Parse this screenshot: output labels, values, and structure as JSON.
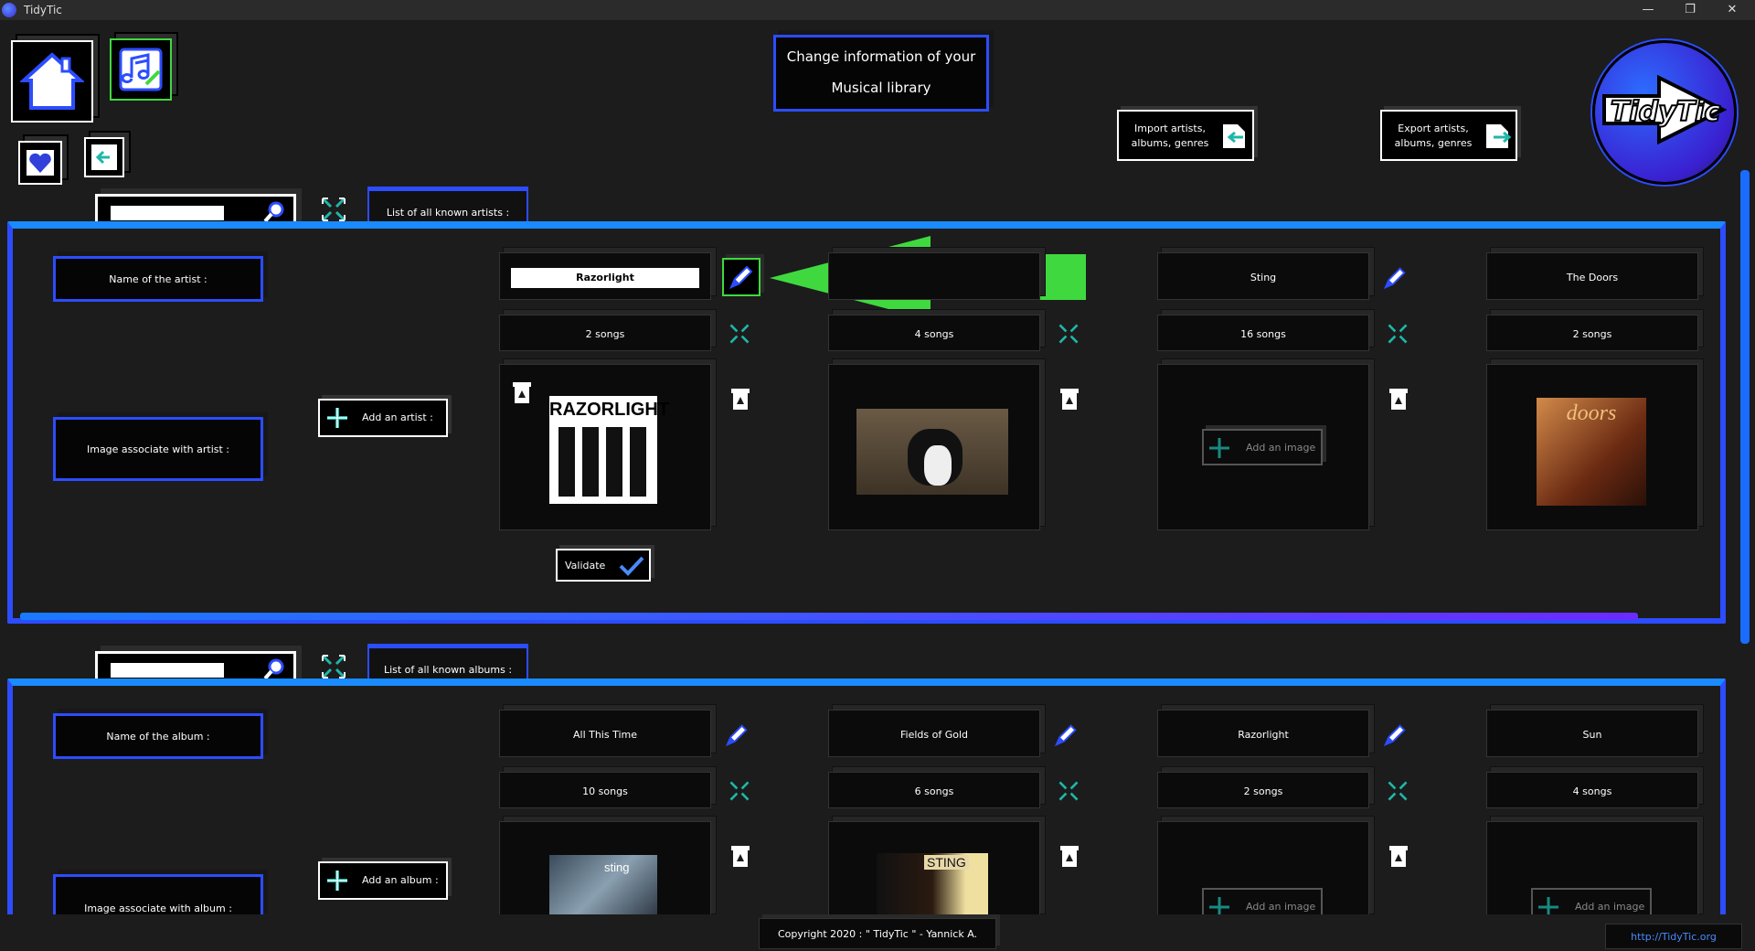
{
  "window": {
    "title": "TidyTic",
    "min": "—",
    "restore": "❐",
    "close": "✕"
  },
  "header": {
    "title_line1": "Change information of your",
    "title_line2": "Musical library",
    "import_label_line1": "Import artists,",
    "import_label_line2": "albums, genres",
    "export_label_line1": "Export artists,",
    "export_label_line2": "albums, genres",
    "logo_text": "TidyTic"
  },
  "artists_section": {
    "tab_label": "List of all known artists :",
    "name_label": "Name of the artist :",
    "image_label": "Image associate with artist :",
    "add_button": "Add an artist :",
    "validate_button": "Validate",
    "edit_value": "Razorlight",
    "items": [
      {
        "name": "Razorlight",
        "songs": "2 songs",
        "image": "RAZORLIGHT"
      },
      {
        "name": "",
        "songs": "4 songs",
        "image": ""
      },
      {
        "name": "Sting",
        "songs": "16 songs",
        "image": "",
        "add_image": "Add an image"
      },
      {
        "name": "The Doors",
        "songs": "2 songs",
        "image": "doors"
      }
    ]
  },
  "albums_section": {
    "tab_label": "List of all known albums :",
    "name_label": "Name of the album :",
    "image_label": "Image associate with album :",
    "add_button": "Add an album :",
    "items": [
      {
        "name": "All This Time",
        "songs": "10 songs",
        "image": "sting"
      },
      {
        "name": "Fields of Gold",
        "songs": "6 songs",
        "image": "STING"
      },
      {
        "name": "Razorlight",
        "songs": "2 songs",
        "add_image": "Add an image"
      },
      {
        "name": "Sun",
        "songs": "4 songs",
        "add_image": "Add an image"
      }
    ]
  },
  "footer": {
    "copyright": "Copyright 2020 : \" TidyTic \" - Yannick A.",
    "link": "http://TidyTic.org"
  },
  "colors": {
    "accent_blue": "#2c4dff",
    "accent_purple": "#5a2bff",
    "green_arrow": "#3fd93f"
  }
}
